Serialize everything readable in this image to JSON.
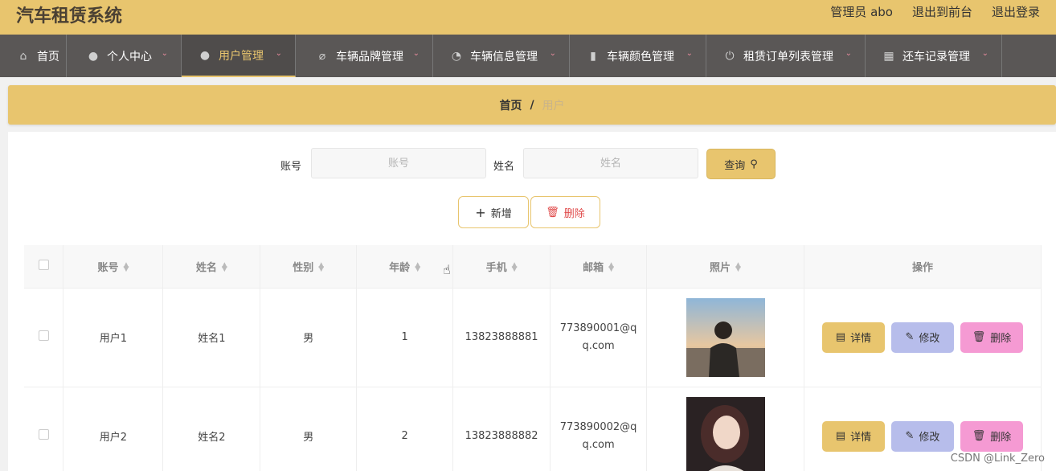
{
  "app": {
    "title": "汽车租赁系统"
  },
  "top_actions": {
    "user": "管理员 abo",
    "front": "退出到前台",
    "logout": "退出登录"
  },
  "nav": [
    {
      "label": "首页",
      "icon": "home-icon",
      "glyph": "⌂",
      "caret": false,
      "active": false
    },
    {
      "label": "个人中心",
      "icon": "person-icon",
      "glyph": "👤",
      "caret": true,
      "active": false
    },
    {
      "label": "用户管理",
      "icon": "person-icon",
      "glyph": "👤",
      "caret": true,
      "active": true
    },
    {
      "label": "车辆品牌管理",
      "icon": "brand-icon",
      "glyph": "⌀",
      "caret": true,
      "active": false
    },
    {
      "label": "车辆信息管理",
      "icon": "dashboard-icon",
      "glyph": "◔",
      "caret": true,
      "active": false
    },
    {
      "label": "车辆颜色管理",
      "icon": "bar-chart-icon",
      "glyph": "▮",
      "caret": true,
      "active": false
    },
    {
      "label": "租赁订单列表管理",
      "icon": "power-icon",
      "glyph": "⏻",
      "caret": true,
      "active": false
    },
    {
      "label": "还车记录管理",
      "icon": "grid-icon",
      "glyph": "▦",
      "caret": true,
      "active": false
    }
  ],
  "breadcrumb": {
    "home": "首页",
    "sep": "/",
    "current": "用户"
  },
  "search": {
    "account_label": "账号",
    "account_placeholder": "账号",
    "name_label": "姓名",
    "name_placeholder": "姓名",
    "query_label": "查询"
  },
  "actions": {
    "add_label": "新增",
    "delete_label": "删除"
  },
  "table": {
    "headers": [
      "账号",
      "姓名",
      "性别",
      "年龄",
      "手机",
      "邮箱",
      "照片",
      "操作"
    ],
    "op_labels": {
      "detail": "详情",
      "edit": "修改",
      "delete": "删除"
    },
    "rows": [
      {
        "account": "用户1",
        "name": "姓名1",
        "gender": "男",
        "age": "1",
        "phone": "13823888881",
        "email": "773890001@qq.com"
      },
      {
        "account": "用户2",
        "name": "姓名2",
        "gender": "男",
        "age": "2",
        "phone": "13823888882",
        "email": "773890002@qq.com"
      }
    ]
  },
  "watermark": "CSDN @Link_Zero",
  "colors": {
    "accent": "#e8c56e",
    "nav_bg": "#5a5756",
    "edit": "#b7bdeb",
    "delete": "#f59ad3"
  }
}
